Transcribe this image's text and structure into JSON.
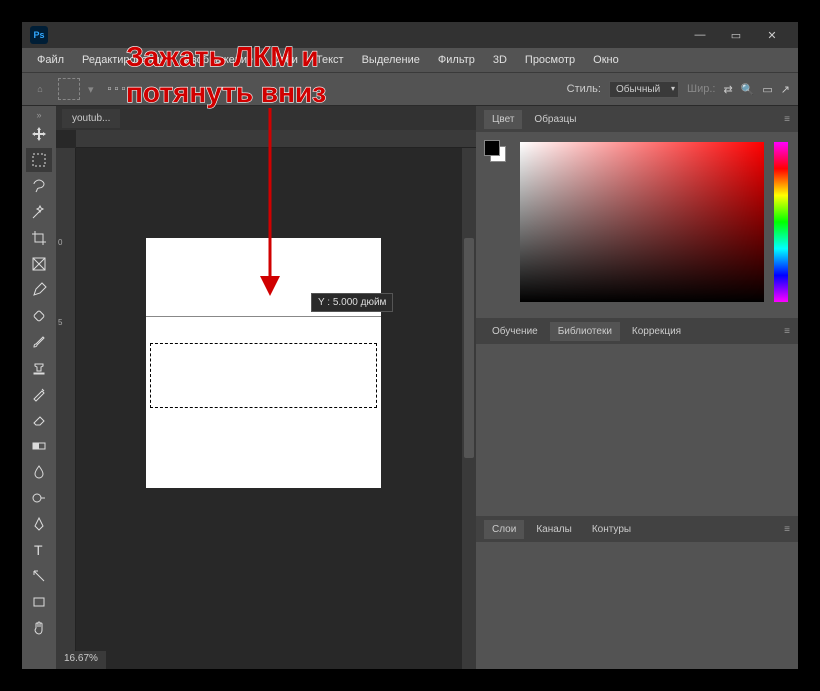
{
  "logo": "Ps",
  "window_buttons": {
    "min": "—",
    "max": "▭",
    "close": "✕"
  },
  "menu": [
    "Файл",
    "Редактирование",
    "Изображение",
    "Слои",
    "Текст",
    "Выделение",
    "Фильтр",
    "3D",
    "Просмотр",
    "Окно"
  ],
  "options": {
    "style_label": "Стиль:",
    "style_value": "Обычный",
    "width_label": "Шир.:"
  },
  "doc_tab": "youtub...",
  "ruler_v": {
    "t1": "0",
    "t2": "5"
  },
  "tooltip": "Y :   5.000 дюйм",
  "zoom": "16.67%",
  "panels": {
    "color": {
      "tabs": [
        "Цвет",
        "Образцы"
      ]
    },
    "mid": {
      "tabs": [
        "Обучение",
        "Библиотеки",
        "Коррекция"
      ],
      "active": 1
    },
    "bottom": {
      "tabs": [
        "Слои",
        "Каналы",
        "Контуры"
      ],
      "active": 0
    }
  },
  "annotation": {
    "line1": "Зажать ЛКМ и",
    "line2": "потянуть вниз"
  },
  "tools": [
    "move",
    "marquee",
    "lasso",
    "wand",
    "crop",
    "frame",
    "eyedrop",
    "heal",
    "brush",
    "stamp",
    "history",
    "eraser",
    "gradient",
    "blur",
    "dodge",
    "pen",
    "type",
    "path",
    "rect",
    "hand"
  ]
}
